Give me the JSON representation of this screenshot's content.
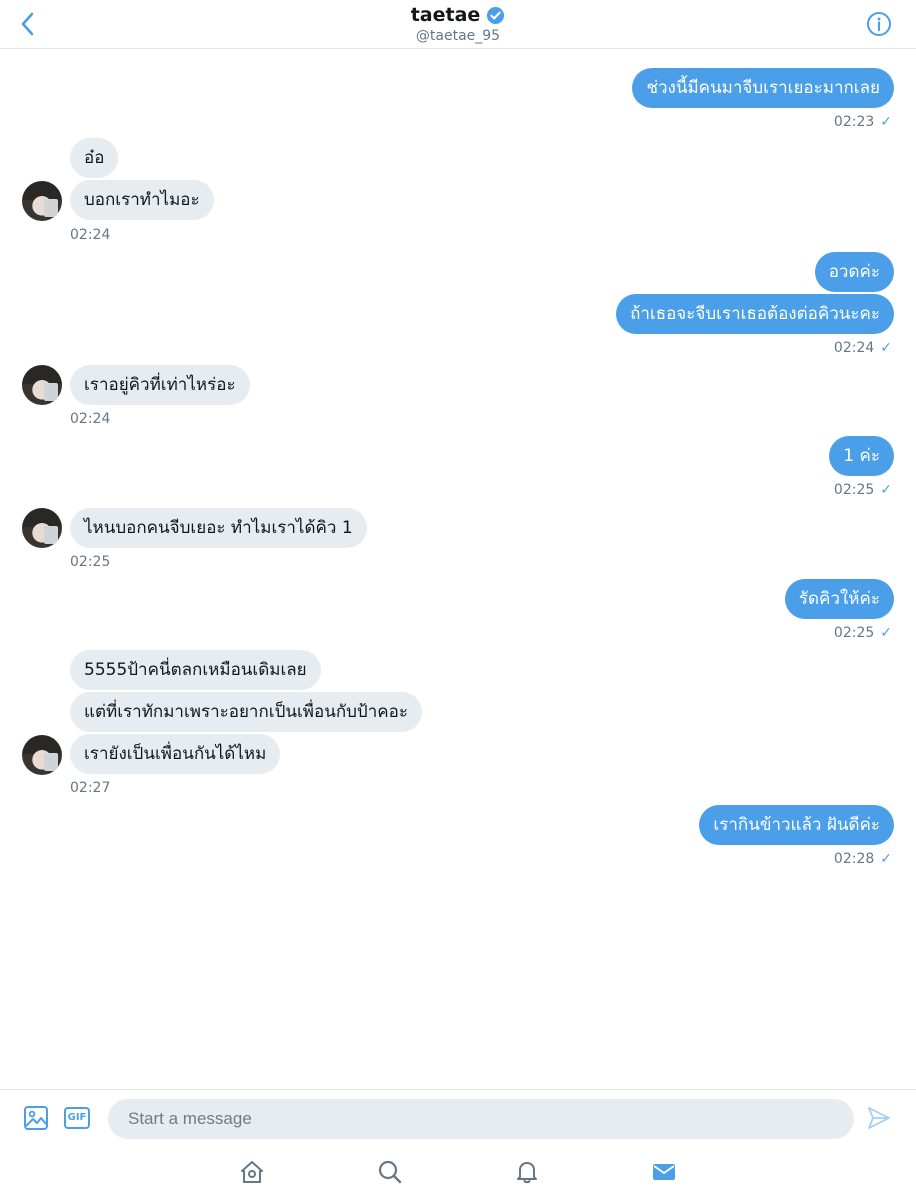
{
  "header": {
    "title": "taetae",
    "handle": "@taetae_95",
    "icons": {
      "back": "chevron-left-icon",
      "verified": "verified-badge-icon",
      "info": "info-icon"
    }
  },
  "messages": [
    {
      "side": "out",
      "text": "ช่วงนี้มีคนมาจีบเราเยอะมากเลย"
    },
    {
      "side": "out",
      "time": "02:23"
    },
    {
      "side": "in",
      "text": "อ๋อ"
    },
    {
      "side": "in",
      "text": "บอกเราทำไมอะ"
    },
    {
      "side": "in",
      "time": "02:24"
    },
    {
      "side": "out",
      "text": "อวดค่ะ"
    },
    {
      "side": "out",
      "text": "ถ้าเธอจะจีบเราเธอต้องต่อคิวนะคะ"
    },
    {
      "side": "out",
      "time": "02:24"
    },
    {
      "side": "in",
      "text": "เราอยู่คิวที่เท่าไหร่อะ"
    },
    {
      "side": "in",
      "time": "02:24"
    },
    {
      "side": "out",
      "text": "1 ค่ะ"
    },
    {
      "side": "out",
      "time": "02:25"
    },
    {
      "side": "in",
      "text": "ไหนบอกคนจีบเยอะ ทำไมเราได้คิว 1"
    },
    {
      "side": "in",
      "time": "02:25"
    },
    {
      "side": "out",
      "text": "รัดคิวให้ค่ะ"
    },
    {
      "side": "out",
      "time": "02:25"
    },
    {
      "side": "in",
      "text": "5555ป้าคนี่ตลกเหมือนเดิมเลย"
    },
    {
      "side": "in",
      "text": "แต่ที่เราทักมาเพราะอยากเป็นเพื่อนกับป้าคอะ"
    },
    {
      "side": "in",
      "text": "เรายังเป็นเพื่อนกันได้ไหม"
    },
    {
      "side": "in",
      "time": "02:27"
    },
    {
      "side": "out",
      "text": "เรากินข้าวแล้ว ฝันดีค่ะ"
    },
    {
      "side": "out",
      "time": "02:28"
    }
  ],
  "read_check": "✓",
  "composer": {
    "placeholder": "Start a message",
    "gif_label": "GIF",
    "icons": {
      "media": "image-icon",
      "gif": "gif-icon",
      "send": "send-icon"
    }
  },
  "tabbar": {
    "tabs": [
      {
        "icon": "home-icon"
      },
      {
        "icon": "search-icon"
      },
      {
        "icon": "notifications-icon"
      },
      {
        "icon": "messages-icon",
        "active": true
      }
    ]
  },
  "colors": {
    "accent": "#4a9fe8",
    "incoming_bubble": "#e6ecf0",
    "muted_text": "#657786",
    "divider": "#e1e8ed"
  }
}
